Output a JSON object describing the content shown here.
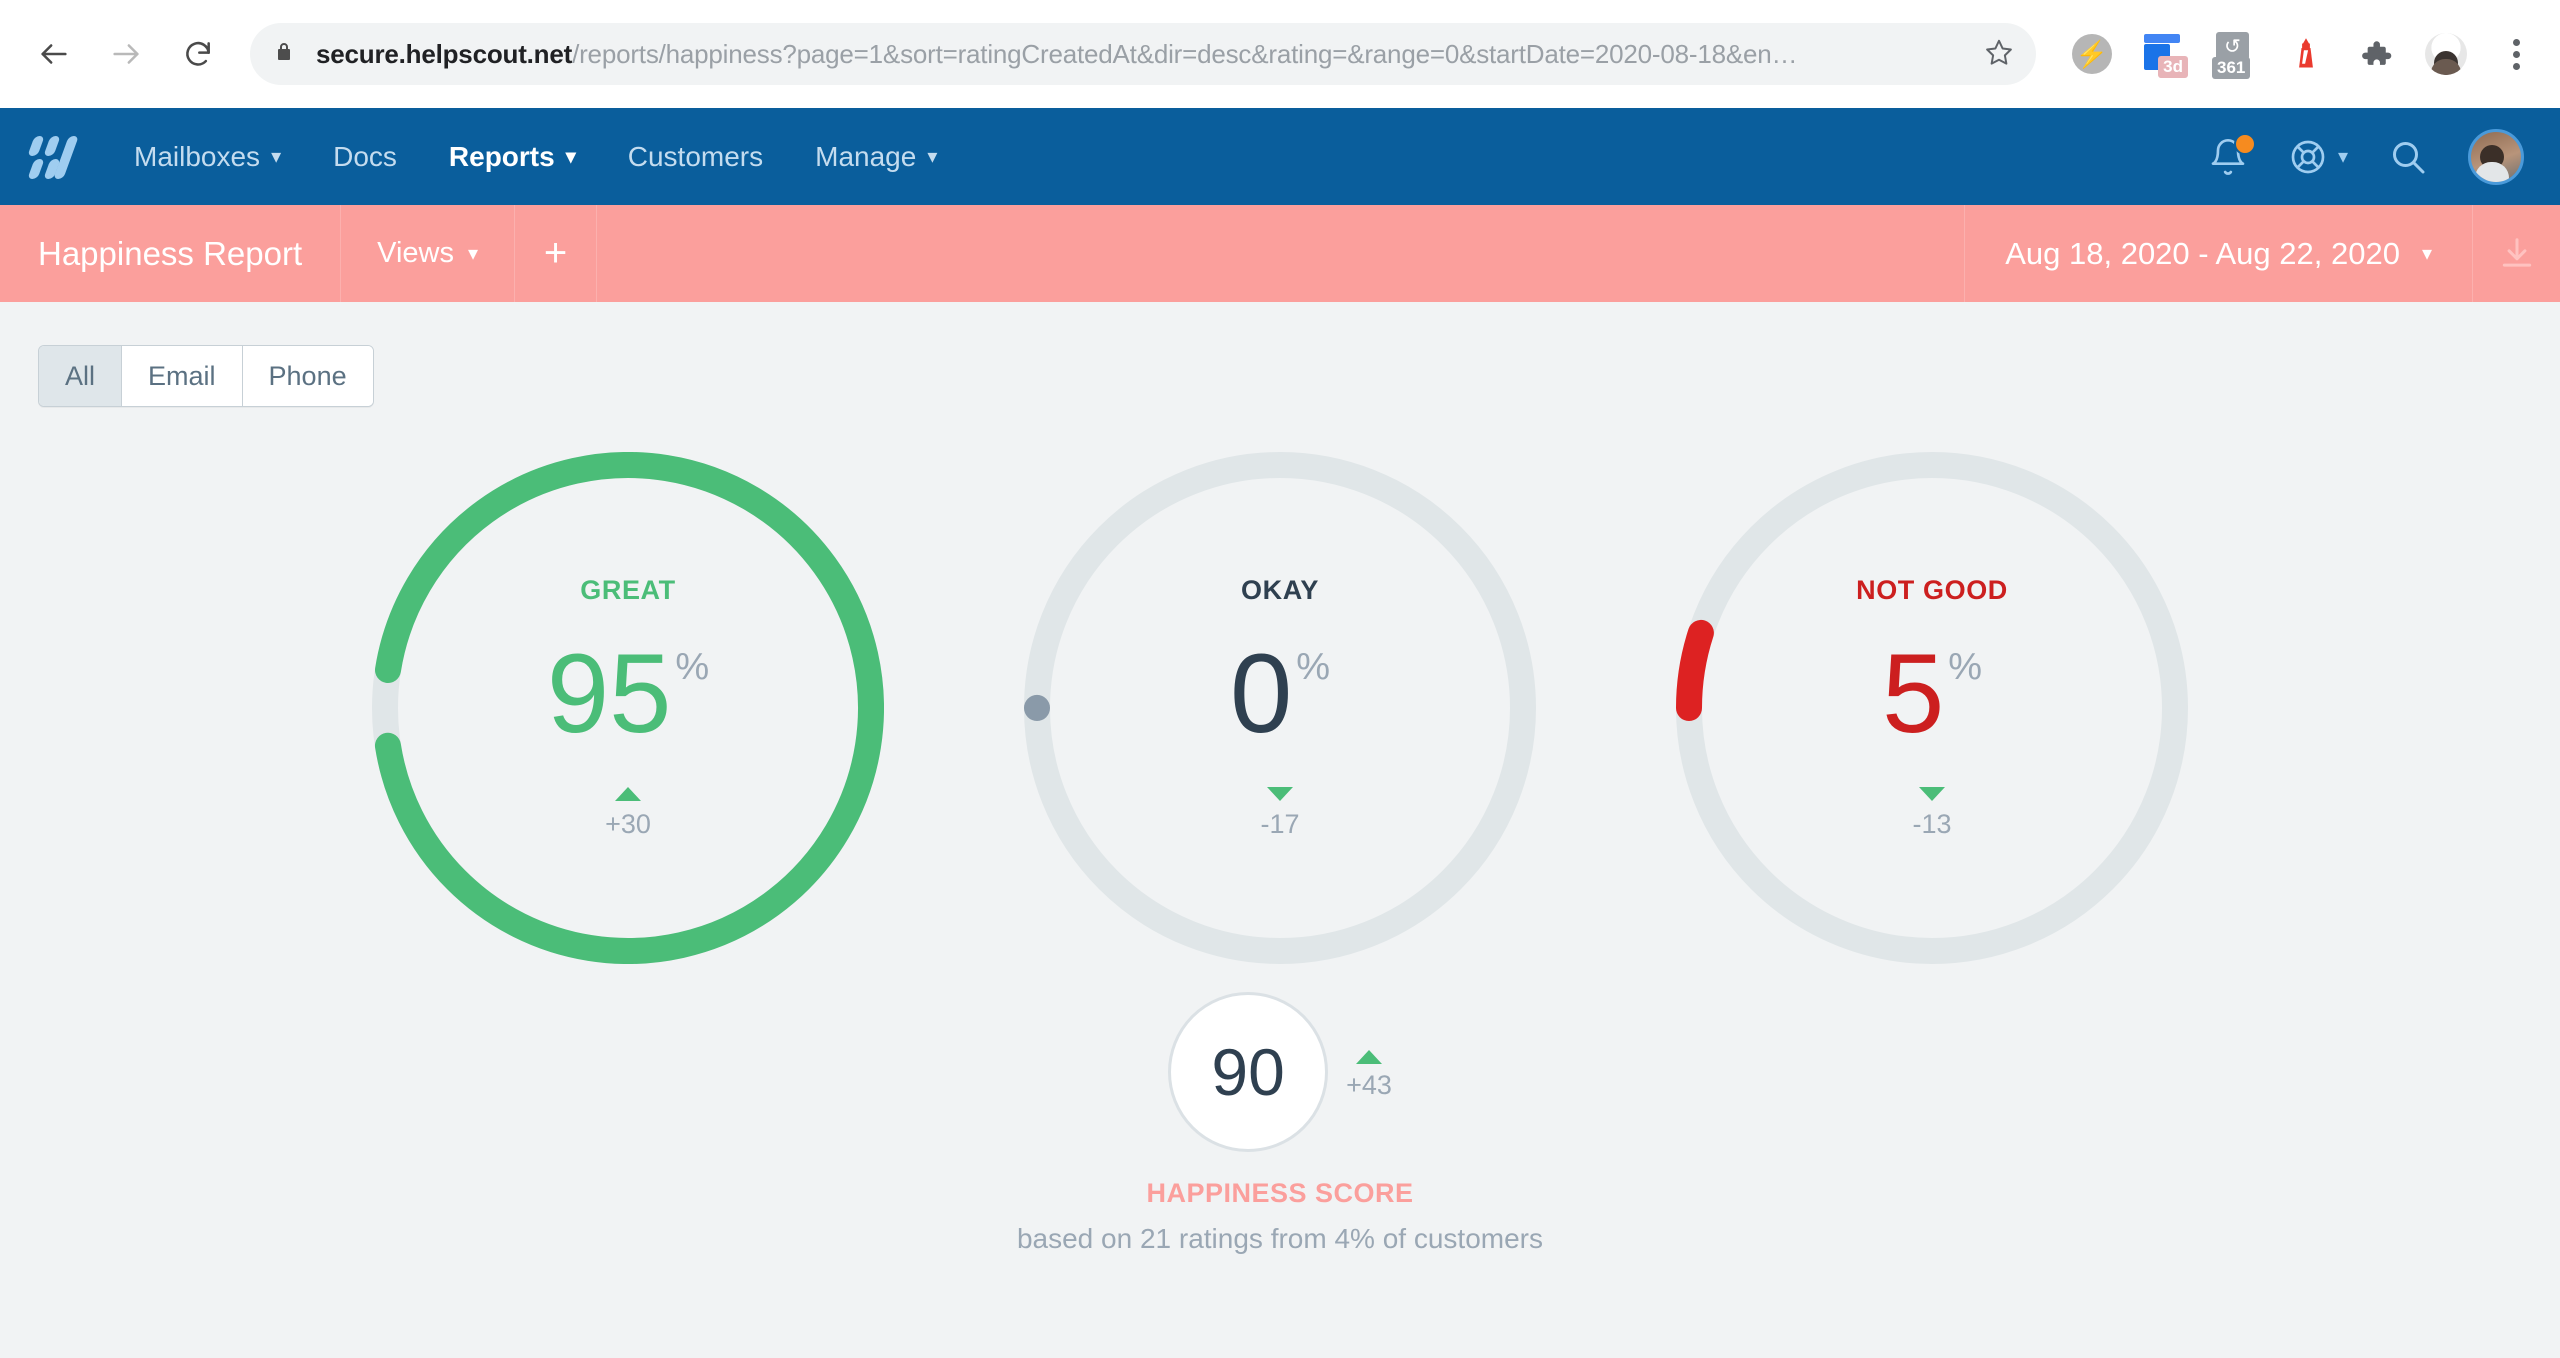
{
  "browser": {
    "back_icon": "back-arrow-icon",
    "forward_icon": "forward-arrow-icon",
    "reload_icon": "reload-icon",
    "lock_icon": "lock-icon",
    "url_domain": "secure.helpscout.net",
    "url_path": "/reports/happiness?page=1&sort=ratingCreatedAt&dir=desc&rating=&range=0&startDate=2020-08-18&en…",
    "bookmark_icon": "star-icon",
    "extensions": [
      {
        "name": "lightning-extension-icon",
        "glyph": "⚡"
      },
      {
        "name": "3d-extension-icon",
        "badge": "3d"
      },
      {
        "name": "history-extension-icon",
        "glyph": "↺",
        "badge": "361"
      },
      {
        "name": "lighthouse-extension-icon",
        "glyph": "🚨"
      },
      {
        "name": "puzzle-extensions-icon"
      },
      {
        "name": "browser-profile-avatar"
      },
      {
        "name": "chrome-menu-icon"
      }
    ]
  },
  "topnav": {
    "logo": "helpscout-logo",
    "items": [
      {
        "label": "Mailboxes",
        "has_caret": true,
        "active": false
      },
      {
        "label": "Docs",
        "has_caret": false,
        "active": false
      },
      {
        "label": "Reports",
        "has_caret": true,
        "active": true
      },
      {
        "label": "Customers",
        "has_caret": false,
        "active": false
      },
      {
        "label": "Manage",
        "has_caret": true,
        "active": false
      }
    ],
    "notifications_icon": "bell-icon",
    "notifications_badge": true,
    "help_icon": "lifebuoy-icon",
    "search_icon": "search-icon",
    "avatar": "user-avatar",
    "background_color": "#0a5e9c"
  },
  "subheader": {
    "title": "Happiness Report",
    "views_label": "Views",
    "add_label": "+",
    "date_range": "Aug 18, 2020 - Aug 22, 2020",
    "download_icon": "download-icon",
    "background_color": "#fb9f9c"
  },
  "filters": {
    "options": [
      {
        "label": "All",
        "selected": true
      },
      {
        "label": "Email",
        "selected": false
      },
      {
        "label": "Phone",
        "selected": false
      }
    ]
  },
  "chart_data": {
    "type": "pie",
    "title": "Happiness Report",
    "subtitle": "based on 21 ratings from 4% of customers",
    "categories": [
      "GREAT",
      "OKAY",
      "NOT GOOD"
    ],
    "values": [
      95,
      0,
      5
    ],
    "units": "%",
    "deltas": [
      "+30",
      "-17",
      "-13"
    ],
    "delta_directions": [
      "up",
      "down",
      "down"
    ],
    "colors": [
      "#4bbd78",
      "#8a9aa9",
      "#dd2222"
    ],
    "track_color": "#e0e6e8",
    "legend": "none",
    "donuts": [
      {
        "label": "GREAT",
        "value": 95,
        "unit": "%",
        "delta": "+30",
        "direction": "up",
        "color": "#4bbd78",
        "label_color": "#4bbd78",
        "value_color": "#4bbd78"
      },
      {
        "label": "OKAY",
        "value": 0,
        "unit": "%",
        "delta": "-17",
        "direction": "down",
        "color": "#8a9aa9",
        "label_color": "#2f4050",
        "value_color": "#2f4050"
      },
      {
        "label": "NOT GOOD",
        "value": 5,
        "unit": "%",
        "delta": "-13",
        "direction": "down",
        "color": "#dd2222",
        "label_color": "#cc1f1f",
        "value_color": "#cc1f1f"
      }
    ],
    "happiness_score": {
      "value": "90",
      "delta": "+43",
      "direction": "up",
      "title": "HAPPINESS SCORE",
      "subtitle": "based on 21 ratings from 4% of customers"
    }
  }
}
